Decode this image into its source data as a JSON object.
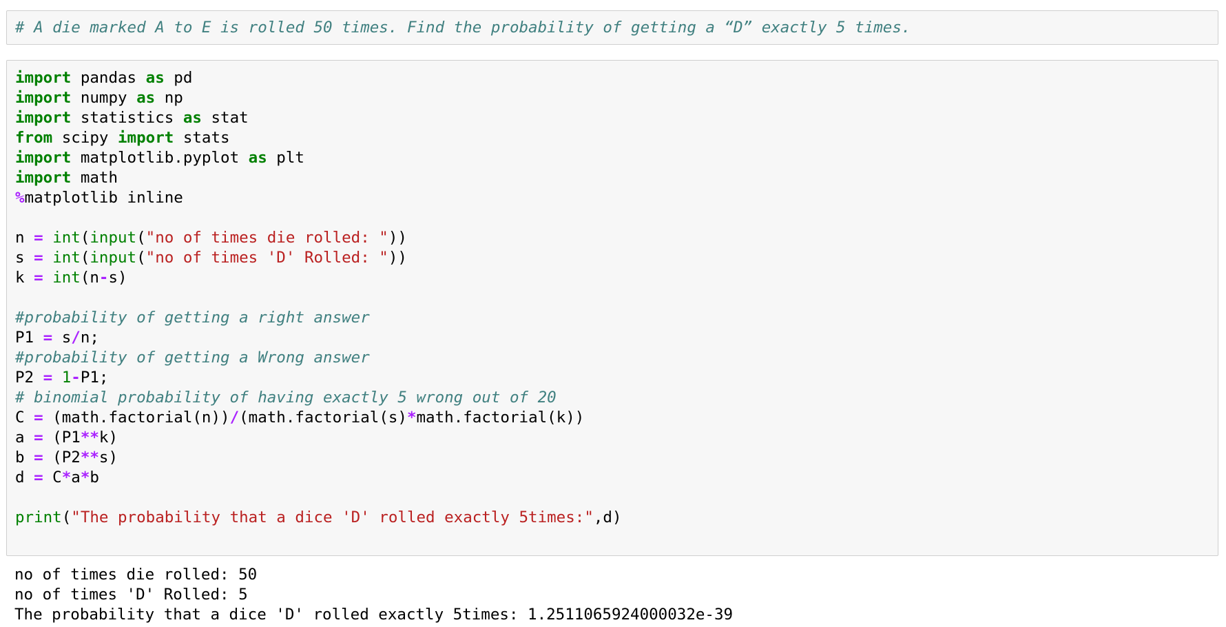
{
  "markdown_cell": {
    "text": "# A die marked A to E is rolled 50 times. Find the probability of getting a “D” exactly 5 times."
  },
  "code_cell": {
    "lines": [
      {
        "tokens": [
          {
            "t": "import",
            "c": "kw"
          },
          {
            "t": " pandas ",
            "c": ""
          },
          {
            "t": "as",
            "c": "kw"
          },
          {
            "t": " pd",
            "c": ""
          }
        ]
      },
      {
        "tokens": [
          {
            "t": "import",
            "c": "kw"
          },
          {
            "t": " numpy ",
            "c": ""
          },
          {
            "t": "as",
            "c": "kw"
          },
          {
            "t": " np",
            "c": ""
          }
        ]
      },
      {
        "tokens": [
          {
            "t": "import",
            "c": "kw"
          },
          {
            "t": " statistics ",
            "c": ""
          },
          {
            "t": "as",
            "c": "kw"
          },
          {
            "t": " stat",
            "c": ""
          }
        ]
      },
      {
        "tokens": [
          {
            "t": "from",
            "c": "kw"
          },
          {
            "t": " scipy ",
            "c": ""
          },
          {
            "t": "import",
            "c": "kw"
          },
          {
            "t": " stats",
            "c": ""
          }
        ]
      },
      {
        "tokens": [
          {
            "t": "import",
            "c": "kw"
          },
          {
            "t": " matplotlib.pyplot ",
            "c": ""
          },
          {
            "t": "as",
            "c": "kw"
          },
          {
            "t": " plt",
            "c": ""
          }
        ]
      },
      {
        "tokens": [
          {
            "t": "import",
            "c": "kw"
          },
          {
            "t": " math",
            "c": ""
          }
        ]
      },
      {
        "tokens": [
          {
            "t": "%",
            "c": "op"
          },
          {
            "t": "matplotlib inline",
            "c": ""
          }
        ]
      },
      {
        "tokens": []
      },
      {
        "tokens": [
          {
            "t": "n ",
            "c": ""
          },
          {
            "t": "=",
            "c": "op"
          },
          {
            "t": " ",
            "c": ""
          },
          {
            "t": "int",
            "c": "bi"
          },
          {
            "t": "(",
            "c": ""
          },
          {
            "t": "input",
            "c": "bi"
          },
          {
            "t": "(",
            "c": ""
          },
          {
            "t": "\"no of times die rolled: \"",
            "c": "st"
          },
          {
            "t": "))",
            "c": ""
          }
        ]
      },
      {
        "tokens": [
          {
            "t": "s ",
            "c": ""
          },
          {
            "t": "=",
            "c": "op"
          },
          {
            "t": " ",
            "c": ""
          },
          {
            "t": "int",
            "c": "bi"
          },
          {
            "t": "(",
            "c": ""
          },
          {
            "t": "input",
            "c": "bi"
          },
          {
            "t": "(",
            "c": ""
          },
          {
            "t": "\"no of times 'D' Rolled: \"",
            "c": "st"
          },
          {
            "t": "))",
            "c": ""
          }
        ]
      },
      {
        "tokens": [
          {
            "t": "k ",
            "c": ""
          },
          {
            "t": "=",
            "c": "op"
          },
          {
            "t": " ",
            "c": ""
          },
          {
            "t": "int",
            "c": "bi"
          },
          {
            "t": "(n",
            "c": ""
          },
          {
            "t": "-",
            "c": "op"
          },
          {
            "t": "s)",
            "c": ""
          }
        ]
      },
      {
        "tokens": []
      },
      {
        "tokens": [
          {
            "t": "#probability of getting a right answer",
            "c": "cm"
          }
        ]
      },
      {
        "tokens": [
          {
            "t": "P1 ",
            "c": ""
          },
          {
            "t": "=",
            "c": "op"
          },
          {
            "t": " s",
            "c": ""
          },
          {
            "t": "/",
            "c": "op"
          },
          {
            "t": "n;",
            "c": ""
          }
        ]
      },
      {
        "tokens": [
          {
            "t": "#probability of getting a Wrong answer",
            "c": "cm"
          }
        ]
      },
      {
        "tokens": [
          {
            "t": "P2 ",
            "c": ""
          },
          {
            "t": "=",
            "c": "op"
          },
          {
            "t": " ",
            "c": ""
          },
          {
            "t": "1",
            "c": "nm"
          },
          {
            "t": "-",
            "c": "op"
          },
          {
            "t": "P1;",
            "c": ""
          }
        ]
      },
      {
        "tokens": [
          {
            "t": "# binomial probability of having exactly 5 wrong out of 20",
            "c": "cm"
          }
        ]
      },
      {
        "tokens": [
          {
            "t": "C ",
            "c": ""
          },
          {
            "t": "=",
            "c": "op"
          },
          {
            "t": " (math.factorial(n))",
            "c": ""
          },
          {
            "t": "/",
            "c": "op"
          },
          {
            "t": "(math.factorial(s)",
            "c": ""
          },
          {
            "t": "*",
            "c": "op"
          },
          {
            "t": "math.factorial(k))",
            "c": ""
          }
        ]
      },
      {
        "tokens": [
          {
            "t": "a ",
            "c": ""
          },
          {
            "t": "=",
            "c": "op"
          },
          {
            "t": " (P1",
            "c": ""
          },
          {
            "t": "**",
            "c": "op"
          },
          {
            "t": "k)",
            "c": ""
          }
        ]
      },
      {
        "tokens": [
          {
            "t": "b ",
            "c": ""
          },
          {
            "t": "=",
            "c": "op"
          },
          {
            "t": " (P2",
            "c": ""
          },
          {
            "t": "**",
            "c": "op"
          },
          {
            "t": "s)",
            "c": ""
          }
        ]
      },
      {
        "tokens": [
          {
            "t": "d ",
            "c": ""
          },
          {
            "t": "=",
            "c": "op"
          },
          {
            "t": " C",
            "c": ""
          },
          {
            "t": "*",
            "c": "op"
          },
          {
            "t": "a",
            "c": ""
          },
          {
            "t": "*",
            "c": "op"
          },
          {
            "t": "b",
            "c": ""
          }
        ]
      },
      {
        "tokens": []
      },
      {
        "tokens": [
          {
            "t": "print",
            "c": "bi"
          },
          {
            "t": "(",
            "c": ""
          },
          {
            "t": "\"The probability that a dice 'D' rolled exactly 5times:\"",
            "c": "st"
          },
          {
            "t": ",d)",
            "c": ""
          }
        ]
      }
    ]
  },
  "output": {
    "lines": [
      "no of times die rolled: 50",
      "no of times 'D' Rolled: 5",
      "The probability that a dice 'D' rolled exactly 5times: 1.2511065924000032e-39"
    ]
  },
  "colors": {
    "keyword": "#008000",
    "builtin": "#008000",
    "operator": "#aa22ff",
    "string": "#ba2121",
    "comment": "#408080",
    "cell_background": "#f7f7f7",
    "cell_border": "#cfcfcf"
  }
}
